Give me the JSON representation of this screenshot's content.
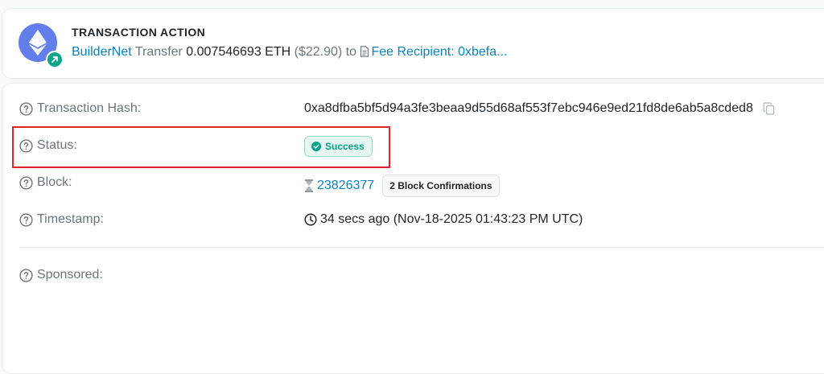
{
  "action": {
    "title": "TRANSACTION ACTION",
    "from_name": "BuilderNet",
    "verb": "Transfer",
    "amount": "0.007546693 ETH",
    "usd": "($22.90)",
    "to_word": "to",
    "recipient": "Fee Recipient: 0xbefa..."
  },
  "details": {
    "tx_hash": {
      "label": "Transaction Hash:",
      "value": "0xa8dfba5bf5d94a3fe3beaa9d55d68af553f7ebc946e9ed21fd8de6ab5a8cded8"
    },
    "status": {
      "label": "Status:",
      "value": "Success"
    },
    "block": {
      "label": "Block:",
      "value": "23826377",
      "confirmations": "2 Block Confirmations"
    },
    "timestamp": {
      "label": "Timestamp:",
      "value": "34 secs ago (Nov-18-2025 01:43:23 PM UTC)"
    },
    "sponsored": {
      "label": "Sponsored:"
    }
  },
  "colors": {
    "link": "#0784c3",
    "success": "#00a186",
    "eth": "#627eea",
    "highlight": "#d9262f"
  }
}
